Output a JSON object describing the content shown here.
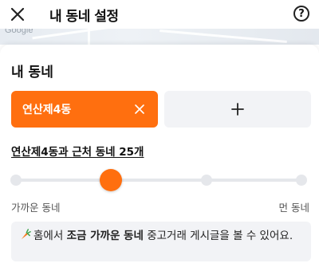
{
  "header": {
    "title": "내 동네 설정",
    "close_icon": "close-icon",
    "help_label": "?"
  },
  "map": {
    "watermark": "Google"
  },
  "main": {
    "section_title": "내 동네",
    "selected_neighborhood": "연산제4동",
    "add_button_label": "+",
    "range_link": "연산제4동과 근처 동네 25개",
    "slider": {
      "steps": 4,
      "selected_step": 2,
      "near_label": "가까운 동네",
      "far_label": "먼 동네"
    },
    "info": {
      "prefix": "홈에서 ",
      "bold": "조금 가까운 동네",
      "suffix": " 중고거래 게시글을 볼 수 있어요."
    }
  },
  "colors": {
    "accent": "#ff6f0f",
    "chip_bg": "#f2f3f6",
    "track": "#e5e7eb"
  }
}
